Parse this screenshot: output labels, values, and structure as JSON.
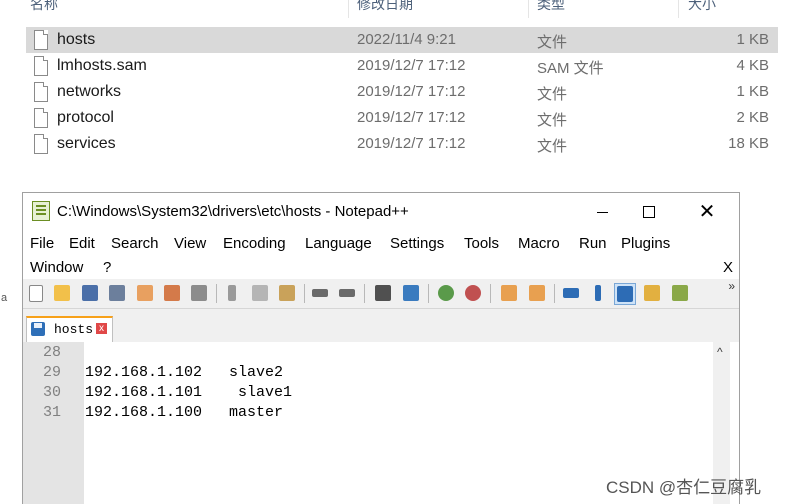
{
  "explorer": {
    "columns": [
      "名称",
      "修改日期",
      "类型",
      "大小"
    ],
    "files": [
      {
        "name": "hosts",
        "date": "2022/11/4 9:21",
        "type": "文件",
        "size": "1 KB",
        "selected": true
      },
      {
        "name": "lmhosts.sam",
        "date": "2019/12/7 17:12",
        "type": "SAM 文件",
        "size": "4 KB",
        "selected": false
      },
      {
        "name": "networks",
        "date": "2019/12/7 17:12",
        "type": "文件",
        "size": "1 KB",
        "selected": false
      },
      {
        "name": "protocol",
        "date": "2019/12/7 17:12",
        "type": "文件",
        "size": "2 KB",
        "selected": false
      },
      {
        "name": "services",
        "date": "2019/12/7 17:12",
        "type": "文件",
        "size": "18 KB",
        "selected": false
      }
    ],
    "left_glyph": "a"
  },
  "notepad": {
    "title": "C:\\Windows\\System32\\drivers\\etc\\hosts - Notepad++",
    "window_controls": {
      "close": "✕"
    },
    "menu": [
      "File",
      "Edit",
      "Search",
      "View",
      "Encoding",
      "Language",
      "Settings",
      "Tools",
      "Macro",
      "Run",
      "Plugins",
      "Window",
      "?"
    ],
    "menu_close": "X",
    "toolbar_more": "»",
    "toolbar_icons": [
      "new-file-icon",
      "open-file-icon",
      "save-icon",
      "save-all-icon",
      "close-icon",
      "close-all-icon",
      "print-icon",
      "cut-icon",
      "copy-icon",
      "paste-icon",
      "undo-icon",
      "redo-icon",
      "find-icon",
      "replace-icon",
      "zoom-in-icon",
      "zoom-out-icon",
      "sync-vertical-icon",
      "sync-horizontal-icon",
      "word-wrap-icon",
      "show-all-chars-icon",
      "indent-guide-icon",
      "document-map-icon",
      "function-list-icon"
    ],
    "tab": {
      "label": "hosts",
      "close": "x"
    },
    "lines": [
      {
        "num": "28",
        "text": ""
      },
      {
        "num": "29",
        "text": "192.168.1.102   slave2"
      },
      {
        "num": "30",
        "text": "192.168.1.101    slave1"
      },
      {
        "num": "31",
        "text": "192.168.1.100   master"
      }
    ],
    "scroll_up": "^"
  },
  "watermark": "CSDN @杏仁豆腐乳",
  "colors": {
    "selected_row": "#d9d9d9",
    "tab_accent": "#f7a11a",
    "gutter": "#e4e4e4"
  }
}
